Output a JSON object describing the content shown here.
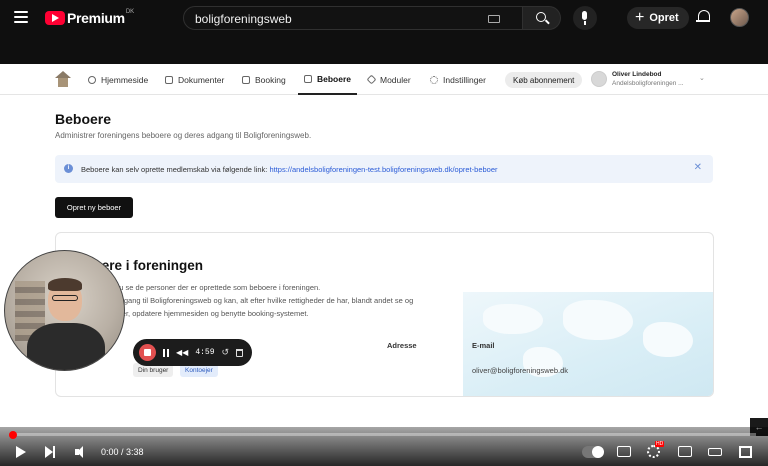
{
  "youtube": {
    "logo_text": "Premium",
    "logo_region": "DK",
    "search_value": "boligforeningsweb",
    "create_label": "Opret",
    "icons": [
      "menu-icon",
      "search-icon",
      "keyboard-icon",
      "mic-icon",
      "bell-icon"
    ]
  },
  "app": {
    "nav": [
      {
        "label": "Hjemmeside",
        "icon": "globe-icon"
      },
      {
        "label": "Dokumenter",
        "icon": "document-icon"
      },
      {
        "label": "Booking",
        "icon": "calendar-icon"
      },
      {
        "label": "Beboere",
        "icon": "users-icon",
        "active": true
      },
      {
        "label": "Moduler",
        "icon": "cube-icon"
      },
      {
        "label": "Indstillinger",
        "icon": "gear-icon"
      }
    ],
    "subscribe_label": "Køb abonnement",
    "user": {
      "name": "Oliver Lindebod",
      "org": "Andelsboligforeningen ..."
    },
    "page_title": "Beboere",
    "page_subtitle": "Administrer foreningens beboere og deres adgang til Boligforeningsweb.",
    "info_text": "Beboere kan selv oprette medlemskab via følgende link: ",
    "info_link": "https://andelsboligforeningen-test.boligforeningsweb.dk/opret-beboer",
    "create_button": "Opret ny beboer",
    "card": {
      "title": "Beboere i foreningen",
      "p1": "Nedenfor kan du se de personer der er oprettede som beboere i foreningen.",
      "p2": "Beboerne har adgang til Boligforeningsweb og kan, alt efter hvilke rettigheder de har, blandt andet se og",
      "p3": "hente dokumenter, opdatere hjemmesiden og benytte booking-systemet.",
      "col_address": "Adresse",
      "col_email": "E-mail",
      "row": {
        "badge1": "Din bruger",
        "badge2": "Kontoejer",
        "email": "oliver@boligforeningsweb.dk"
      }
    }
  },
  "recorder": {
    "time": "4:59"
  },
  "player": {
    "time": "0:00 / 3:38",
    "progress": 0.0,
    "accent": "#ff0000"
  }
}
